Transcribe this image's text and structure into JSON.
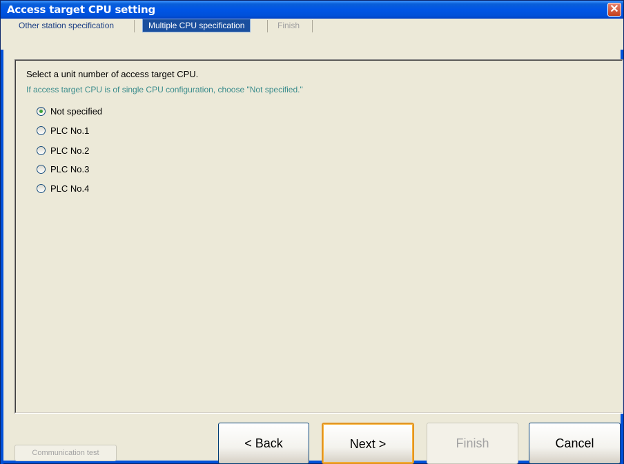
{
  "window": {
    "title": "Access target CPU setting",
    "close_glyph": "✕"
  },
  "tabs": [
    {
      "label": "Other station specification",
      "state": "normal"
    },
    {
      "label": "Multiple CPU specification",
      "state": "active"
    },
    {
      "label": "Finish",
      "state": "disabled"
    }
  ],
  "panel": {
    "instruction": "Select a unit number of access target CPU.",
    "hint": "If access target CPU is of single CPU configuration, choose \"Not specified.\"",
    "options": [
      {
        "label": "Not specified",
        "checked": true
      },
      {
        "label": "PLC No.1",
        "checked": false
      },
      {
        "label": "PLC No.2",
        "checked": false
      },
      {
        "label": "PLC No.3",
        "checked": false
      },
      {
        "label": "PLC No.4",
        "checked": false
      }
    ]
  },
  "buttons": {
    "communication_test": "Communication test",
    "back": "< Back",
    "next": "Next >",
    "finish": "Finish",
    "cancel": "Cancel"
  },
  "colors": {
    "titlebar": "#0050d8",
    "active_tab": "#1a4f9e",
    "hint_text": "#3a8c8c",
    "default_button_border": "#e29523"
  }
}
